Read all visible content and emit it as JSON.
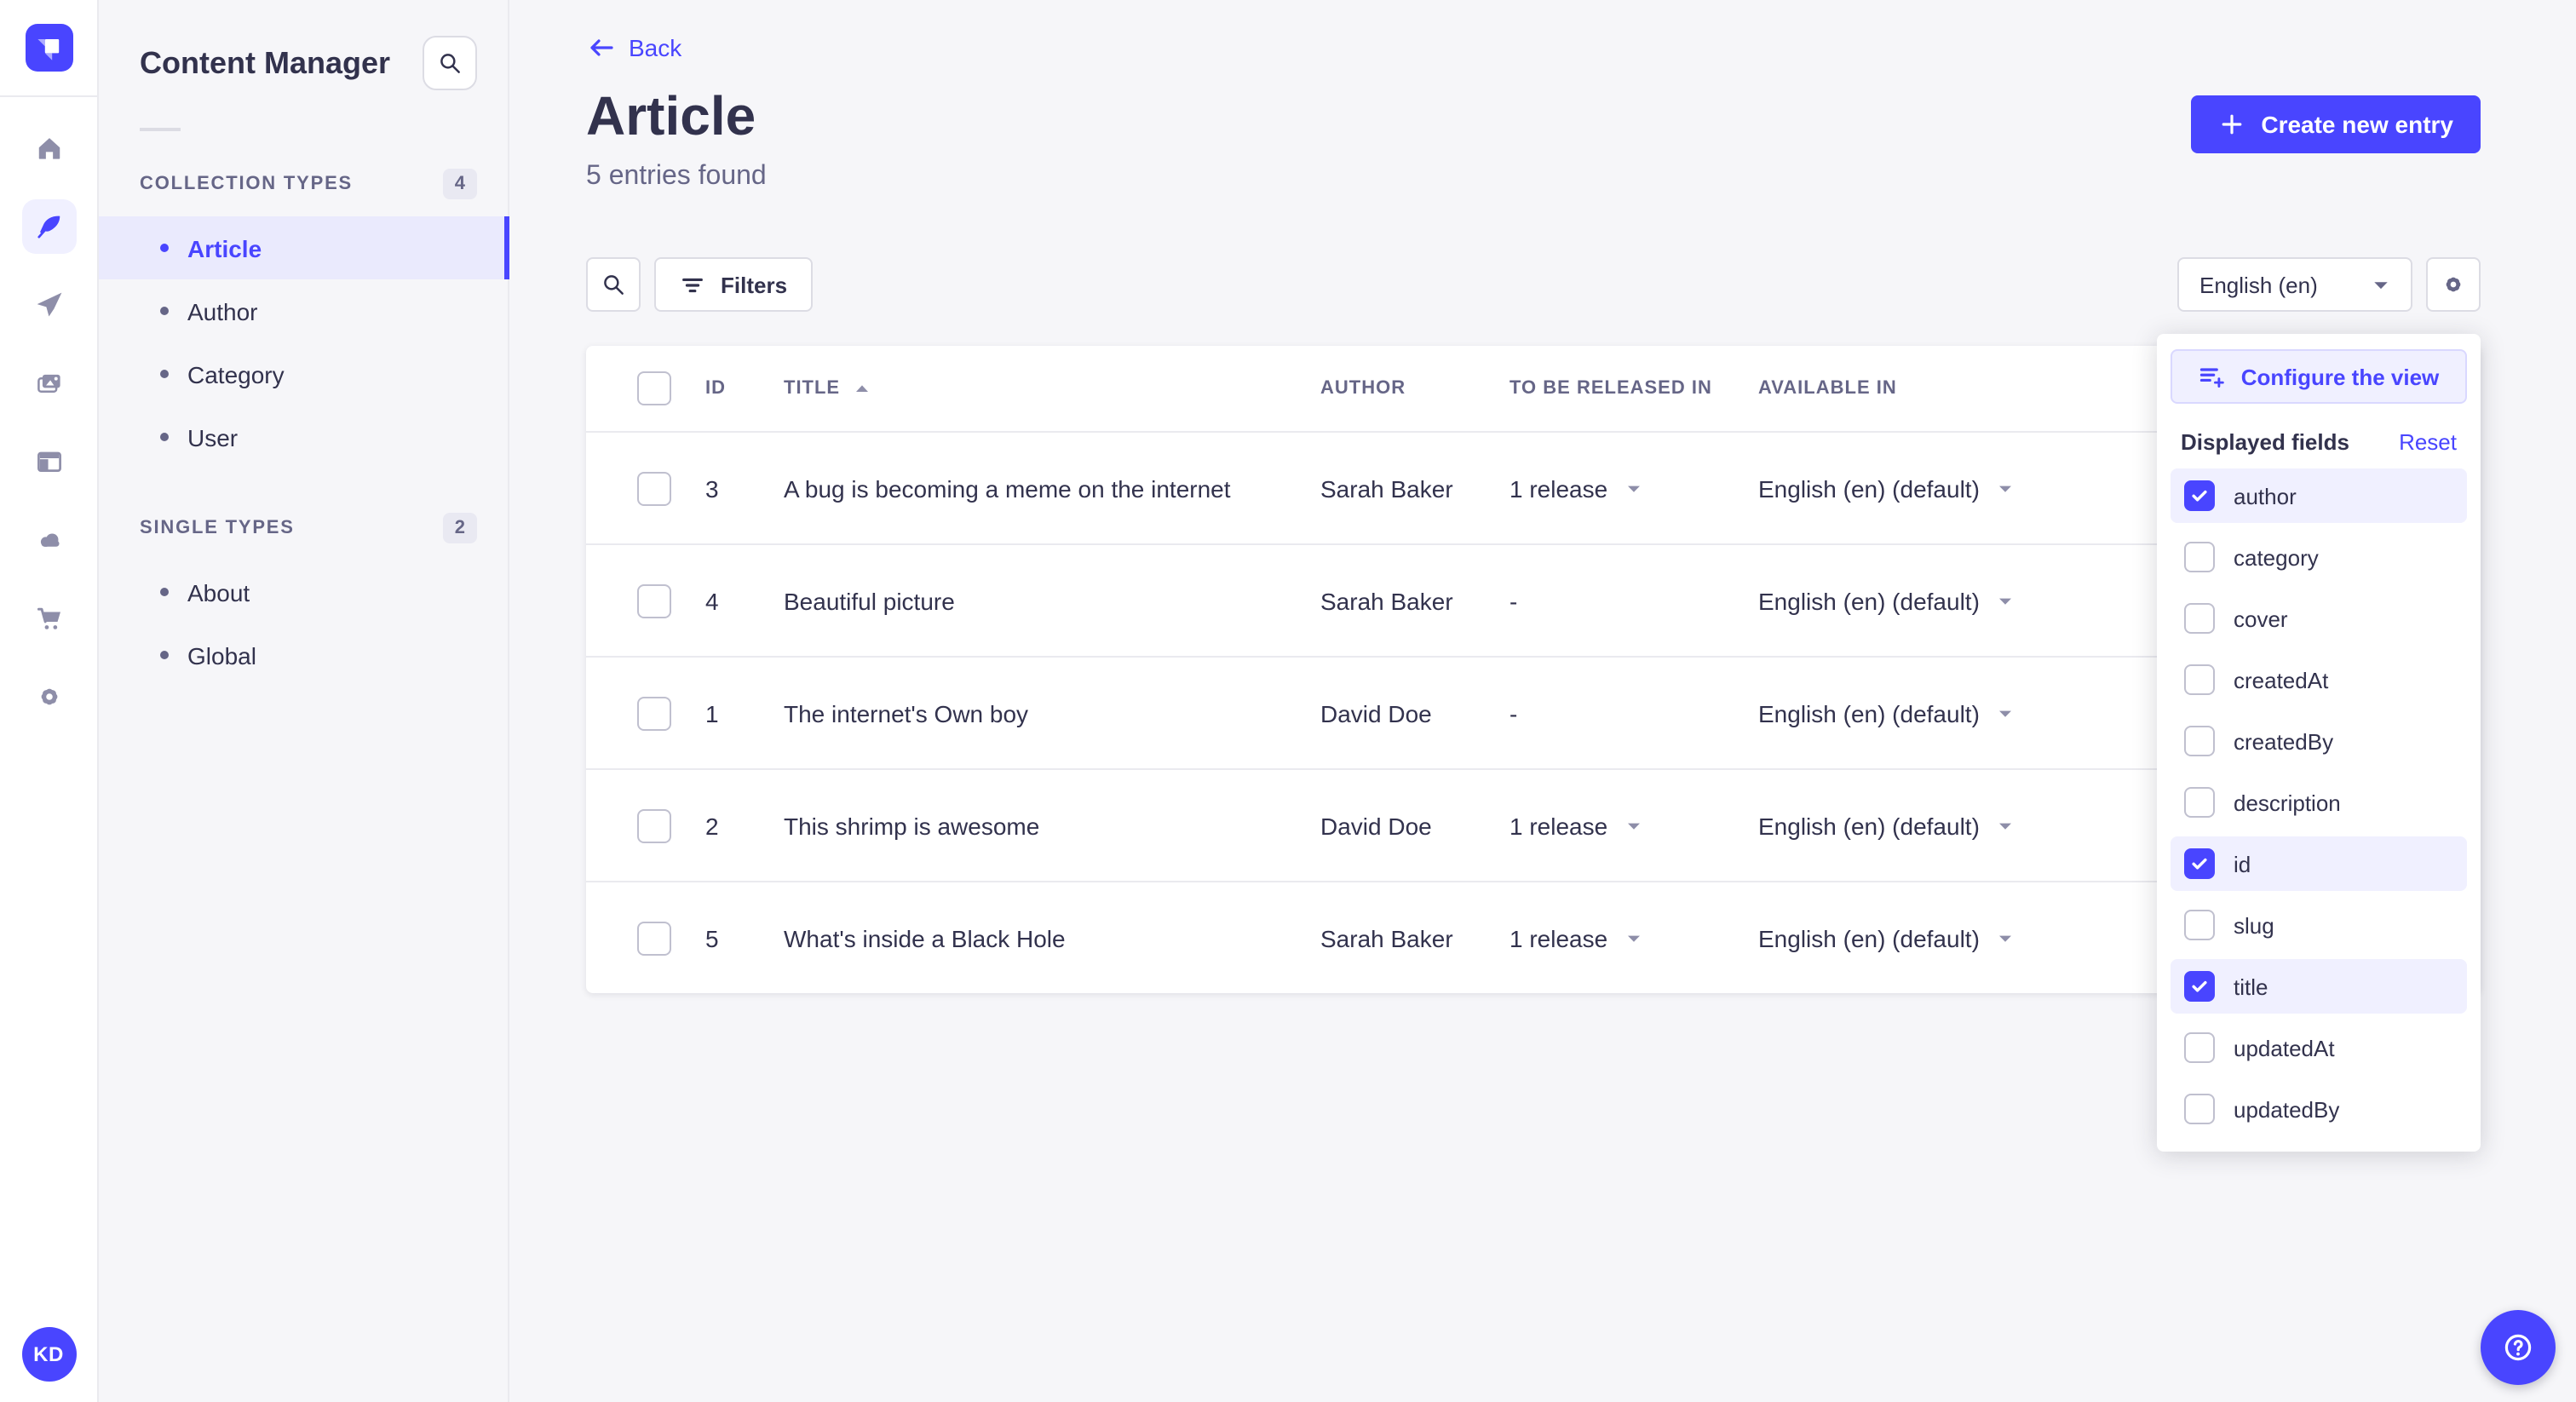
{
  "colors": {
    "accent": "#4945ff",
    "accent_bg": "#f0f0ff",
    "text": "#32324d",
    "text_muted": "#666687"
  },
  "nav": {
    "logo_icon": "strapi-logo",
    "icons": [
      "home-icon",
      "content-manager-icon",
      "releases-icon",
      "media-library-icon",
      "webpages-icon",
      "deploy-icon",
      "purchases-icon",
      "settings-icon"
    ],
    "active_icon": "content-manager-icon",
    "avatar_initials": "KD"
  },
  "sidebar": {
    "title": "Content Manager",
    "sections": [
      {
        "label": "COLLECTION TYPES",
        "badge": "4",
        "items": [
          {
            "label": "Article",
            "active": true
          },
          {
            "label": "Author",
            "active": false
          },
          {
            "label": "Category",
            "active": false
          },
          {
            "label": "User",
            "active": false
          }
        ]
      },
      {
        "label": "SINGLE TYPES",
        "badge": "2",
        "items": [
          {
            "label": "About",
            "active": false
          },
          {
            "label": "Global",
            "active": false
          }
        ]
      }
    ]
  },
  "header": {
    "back_label": "Back",
    "title": "Article",
    "subtitle": "5 entries found",
    "create_label": "Create new entry"
  },
  "toolbar": {
    "filters_label": "Filters",
    "locale_value": "English (en)"
  },
  "table": {
    "headers": {
      "id": "ID",
      "title": "TITLE",
      "author": "AUTHOR",
      "released": "TO BE RELEASED IN",
      "available": "AVAILABLE IN"
    },
    "sort": {
      "column": "TITLE",
      "direction": "asc"
    },
    "rows": [
      {
        "id": "3",
        "title": "A bug is becoming a meme on the internet",
        "author": "Sarah Baker",
        "released": "1 release",
        "available": "English (en) (default)"
      },
      {
        "id": "4",
        "title": "Beautiful picture",
        "author": "Sarah Baker",
        "released": "-",
        "available": "English (en) (default)"
      },
      {
        "id": "1",
        "title": "The internet's Own boy",
        "author": "David Doe",
        "released": "-",
        "available": "English (en) (default)"
      },
      {
        "id": "2",
        "title": "This shrimp is awesome",
        "author": "David Doe",
        "released": "1 release",
        "available": "English (en) (default)"
      },
      {
        "id": "5",
        "title": "What's inside a Black Hole",
        "author": "Sarah Baker",
        "released": "1 release",
        "available": "English (en) (default)"
      }
    ]
  },
  "popover": {
    "configure_label": "Configure the view",
    "fields_title": "Displayed fields",
    "reset_label": "Reset",
    "fields": [
      {
        "label": "author",
        "checked": true
      },
      {
        "label": "category",
        "checked": false
      },
      {
        "label": "cover",
        "checked": false
      },
      {
        "label": "createdAt",
        "checked": false
      },
      {
        "label": "createdBy",
        "checked": false
      },
      {
        "label": "description",
        "checked": false
      },
      {
        "label": "id",
        "checked": true
      },
      {
        "label": "slug",
        "checked": false
      },
      {
        "label": "title",
        "checked": true
      },
      {
        "label": "updatedAt",
        "checked": false
      },
      {
        "label": "updatedBy",
        "checked": false
      }
    ]
  },
  "help": {
    "icon": "question-mark-icon"
  }
}
